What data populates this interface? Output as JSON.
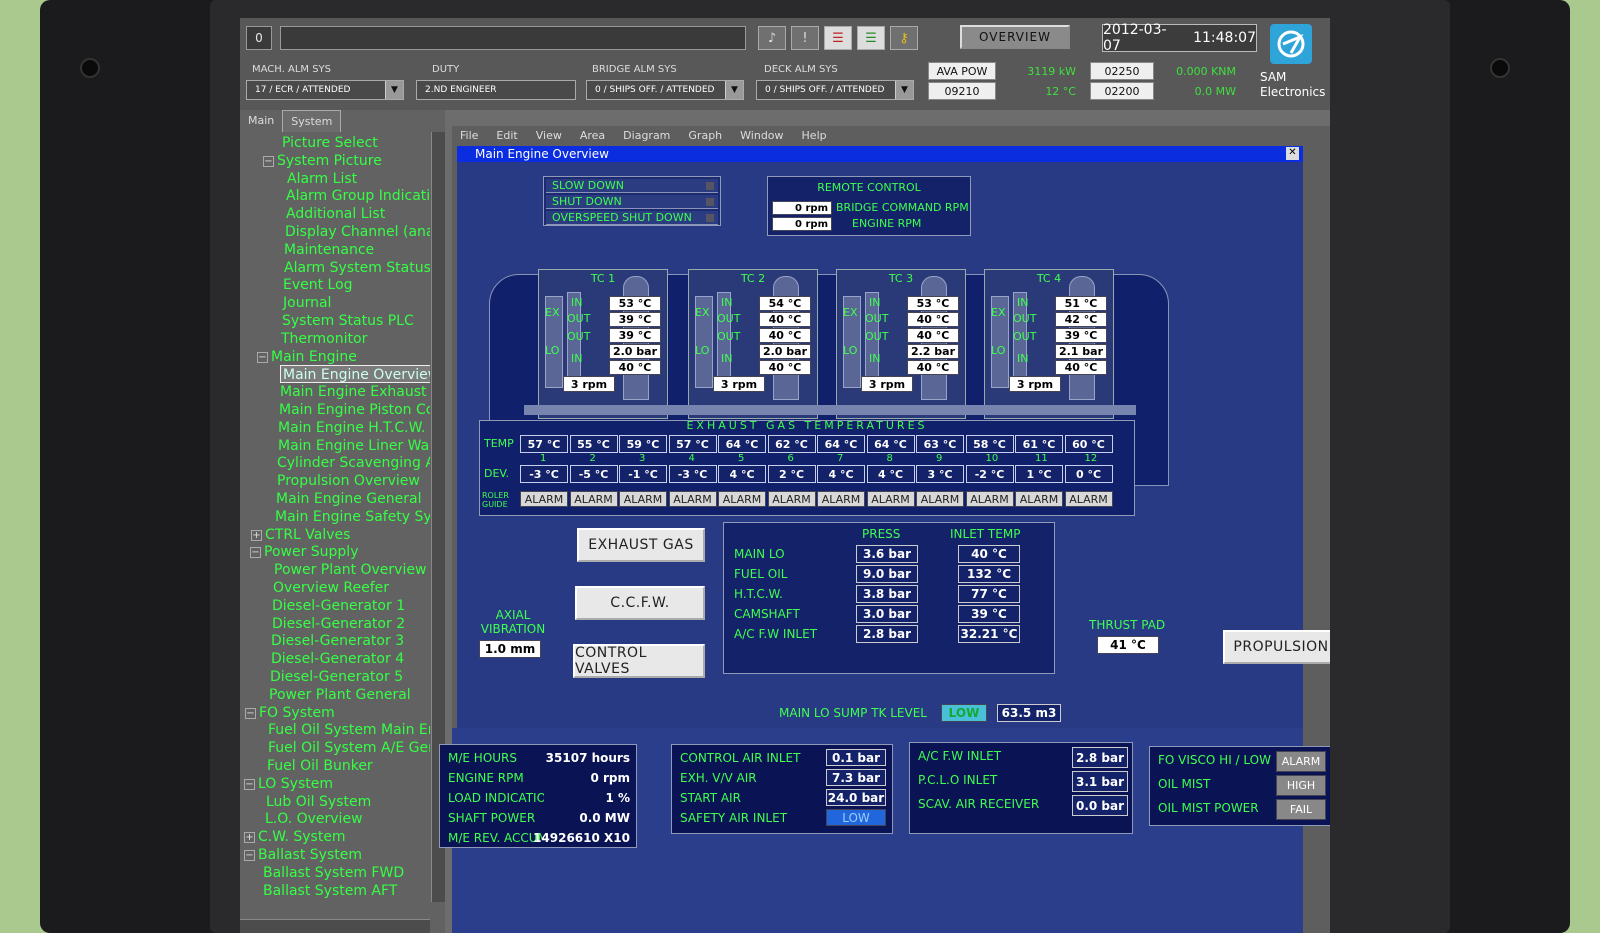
{
  "topbar": {
    "counter": "0",
    "overview_label": "OVERVIEW",
    "date": "2012-03-07",
    "time": "11:48:07",
    "brand_line1": "SAM",
    "brand_line2": "Electronics",
    "groups": [
      {
        "label": "MACH. ALM SYS",
        "value": "17 / ECR / ATTENDED"
      },
      {
        "label": "DUTY",
        "value": "2.ND ENGINEER"
      },
      {
        "label": "BRIDGE ALM SYS",
        "value": "0 / SHIPS OFF. / ATTENDED"
      },
      {
        "label": "DECK ALM SYS",
        "value": "0 / SHIPS OFF. / ATTENDED"
      }
    ],
    "power": {
      "ava_pow_label": "AVA POW",
      "ava_pow_value": "3119 kW",
      "box1": "02250",
      "knm": "0.000 KNM",
      "box2": "09210",
      "temp": "12 °C",
      "box3": "02200",
      "mw": "0.0 MW"
    }
  },
  "sidebar": {
    "tab_main": "Main",
    "tab_system": "System",
    "items": [
      {
        "label": "Picture Select",
        "level": 2,
        "exp": ""
      },
      {
        "label": "System Picture",
        "level": 1,
        "exp": "−"
      },
      {
        "label": "Alarm List",
        "level": 3,
        "exp": ""
      },
      {
        "label": "Alarm Group Indication",
        "level": 3,
        "exp": ""
      },
      {
        "label": "Additional List",
        "level": 3,
        "exp": ""
      },
      {
        "label": "Display Channel (analogue",
        "level": 3,
        "exp": ""
      },
      {
        "label": "Maintenance",
        "level": 3,
        "exp": ""
      },
      {
        "label": "Alarm System Status",
        "level": 3,
        "exp": ""
      },
      {
        "label": "Event Log",
        "level": 3,
        "exp": ""
      },
      {
        "label": "Journal",
        "level": 3,
        "exp": ""
      },
      {
        "label": "System Status PLC",
        "level": 3,
        "exp": ""
      },
      {
        "label": "Thermonitor",
        "level": 3,
        "exp": ""
      },
      {
        "label": "Main Engine",
        "level": 1,
        "exp": "−"
      },
      {
        "label": "Main Engine Overview",
        "level": 3,
        "exp": "",
        "selected": true
      },
      {
        "label": "Main Engine Exhaust Gas",
        "level": 3,
        "exp": ""
      },
      {
        "label": "Main Engine Piston Cooli",
        "level": 3,
        "exp": ""
      },
      {
        "label": "Main Engine H.T.C.W.",
        "level": 3,
        "exp": ""
      },
      {
        "label": "Main Engine Liner Wall Te",
        "level": 3,
        "exp": ""
      },
      {
        "label": "Cylinder Scavenging Air B",
        "level": 3,
        "exp": ""
      },
      {
        "label": "Propulsion Overview",
        "level": 3,
        "exp": ""
      },
      {
        "label": "Main Engine General",
        "level": 3,
        "exp": ""
      },
      {
        "label": "Main Engine Safety Syste",
        "level": 3,
        "exp": ""
      },
      {
        "label": "CTRL Valves",
        "level": 1,
        "exp": "+"
      },
      {
        "label": "Power Supply",
        "level": 1,
        "exp": "−"
      },
      {
        "label": "Power Plant Overview",
        "level": 3,
        "exp": ""
      },
      {
        "label": "Overview Reefer",
        "level": 3,
        "exp": ""
      },
      {
        "label": "Diesel-Generator 1",
        "level": 3,
        "exp": ""
      },
      {
        "label": "Diesel-Generator 2",
        "level": 3,
        "exp": ""
      },
      {
        "label": "Diesel-Generator 3",
        "level": 3,
        "exp": ""
      },
      {
        "label": "Diesel-Generator 4",
        "level": 3,
        "exp": ""
      },
      {
        "label": "Diesel-Generator 5",
        "level": 3,
        "exp": ""
      },
      {
        "label": "Power Plant General",
        "level": 3,
        "exp": ""
      },
      {
        "label": "FO System",
        "level": 1,
        "exp": "−"
      },
      {
        "label": "Fuel Oil System Main Eng",
        "level": 3,
        "exp": ""
      },
      {
        "label": "Fuel Oil System A/E Gene",
        "level": 3,
        "exp": ""
      },
      {
        "label": "Fuel Oil Bunker",
        "level": 3,
        "exp": ""
      },
      {
        "label": "LO System",
        "level": 1,
        "exp": "−"
      },
      {
        "label": "Lub Oil System",
        "level": 3,
        "exp": ""
      },
      {
        "label": "L.O. Overview",
        "level": 3,
        "exp": ""
      },
      {
        "label": "C.W. System",
        "level": 1,
        "exp": "+"
      },
      {
        "label": "Ballast System",
        "level": 1,
        "exp": "−"
      },
      {
        "label": "Ballast System FWD",
        "level": 3,
        "exp": ""
      },
      {
        "label": "Ballast System AFT",
        "level": 3,
        "exp": ""
      }
    ]
  },
  "menu": [
    "File",
    "Edit",
    "View",
    "Area",
    "Diagram",
    "Graph",
    "Window",
    "Help"
  ],
  "window_title": "Main Engine Overview",
  "shutdowns": [
    "SLOW DOWN",
    "SHUT DOWN",
    "OVERSPEED SHUT DOWN"
  ],
  "remote": {
    "title": "REMOTE CONTROL",
    "bridge_val": "0 rpm",
    "bridge_label": "BRIDGE COMMAND RPM",
    "engine_val": "0 rpm",
    "engine_label": "ENGINE RPM"
  },
  "tc_labels": {
    "ex": "EX",
    "lo": "LO",
    "in": "IN",
    "out": "OUT"
  },
  "turbochargers": [
    {
      "name": "TC 1",
      "v1": "53 °C",
      "v2": "39 °C",
      "v3": "39 °C",
      "v4": "2.0 bar",
      "v5": "40 °C",
      "rpm": "3 rpm"
    },
    {
      "name": "TC 2",
      "v1": "54 °C",
      "v2": "40 °C",
      "v3": "40 °C",
      "v4": "2.0 bar",
      "v5": "40 °C",
      "rpm": "3 rpm"
    },
    {
      "name": "TC 3",
      "v1": "53 °C",
      "v2": "40 °C",
      "v3": "40 °C",
      "v4": "2.2 bar",
      "v5": "40 °C",
      "rpm": "3 rpm"
    },
    {
      "name": "TC 4",
      "v1": "51 °C",
      "v2": "42 °C",
      "v3": "39 °C",
      "v4": "2.1 bar",
      "v5": "40 °C",
      "rpm": "3 rpm"
    }
  ],
  "egt": {
    "title": "EXHAUST GAS TEMPERATURES",
    "temp_label": "TEMP",
    "dev_label": "DEV.",
    "roller_label_1": "ROLER",
    "roller_label_2": "GUIDE",
    "temps": [
      "57 °C",
      "55 °C",
      "59 °C",
      "57 °C",
      "64 °C",
      "62 °C",
      "64 °C",
      "64 °C",
      "63 °C",
      "58 °C",
      "61 °C",
      "60 °C"
    ],
    "cyl": [
      "1",
      "2",
      "3",
      "4",
      "5",
      "6",
      "7",
      "8",
      "9",
      "10",
      "11",
      "12"
    ],
    "devs": [
      "-3 °C",
      "-5 °C",
      "-1 °C",
      "-3 °C",
      "4 °C",
      "2 °C",
      "4 °C",
      "4 °C",
      "3 °C",
      "-2 °C",
      "1 °C",
      "0 °C"
    ],
    "alarm": "ALARM"
  },
  "buttons": {
    "exhaust": "EXHAUST GAS",
    "ccfw": "C.C.F.W.",
    "ctrl_valves": "CONTROL VALVES",
    "propulsion": "PROPULSION"
  },
  "axial": {
    "label1": "AXIAL",
    "label2": "VIBRATION",
    "value": "1.0 mm"
  },
  "thrust": {
    "label": "THRUST PAD",
    "value": "41 °C"
  },
  "lube": {
    "press_header": "PRESS",
    "temp_header": "INLET TEMP",
    "rows": [
      {
        "label": "MAIN LO",
        "press": "3.6 bar",
        "temp": "40 °C"
      },
      {
        "label": "FUEL OIL",
        "press": "9.0 bar",
        "temp": "132 °C"
      },
      {
        "label": "H.T.C.W.",
        "press": "3.8 bar",
        "temp": "77 °C"
      },
      {
        "label": "CAMSHAFT",
        "press": "3.0 bar",
        "temp": "39 °C"
      },
      {
        "label": "A/C F.W INLET",
        "press": "2.8 bar",
        "temp": "32.21 °C"
      }
    ]
  },
  "sump": {
    "label": "MAIN LO SUMP TK LEVEL",
    "status": "LOW",
    "value": "63.5 m3"
  },
  "stats": [
    {
      "label": "M/E HOURS",
      "value": "35107 hours"
    },
    {
      "label": "ENGINE RPM",
      "value": "0 rpm"
    },
    {
      "label": "LOAD INDICATION",
      "value": "1 %"
    },
    {
      "label": "SHAFT POWER",
      "value": "0.0 MW"
    },
    {
      "label": "M/E REV. ACCUM",
      "value": "14926610 X10"
    }
  ],
  "air": [
    {
      "label": "CONTROL AIR INLET",
      "value": "0.1 bar"
    },
    {
      "label": "EXH. V/V AIR",
      "value": "7.3 bar"
    },
    {
      "label": "START AIR",
      "value": "24.0 bar"
    },
    {
      "label": "SAFETY AIR INLET",
      "value": "LOW"
    }
  ],
  "fw": [
    {
      "label": "A/C F.W INLET",
      "value": "2.8 bar"
    },
    {
      "label": "P.C.L.O INLET",
      "value": "3.1 bar"
    },
    {
      "label": "SCAV. AIR RECEIVER",
      "value": "0.0 bar"
    }
  ],
  "mist": [
    {
      "label": "FO VISCO HI / LOW",
      "value": "ALARM"
    },
    {
      "label": "OIL MIST",
      "value": "HIGH"
    },
    {
      "label": "OIL MIST POWER",
      "value": "FAIL"
    }
  ]
}
